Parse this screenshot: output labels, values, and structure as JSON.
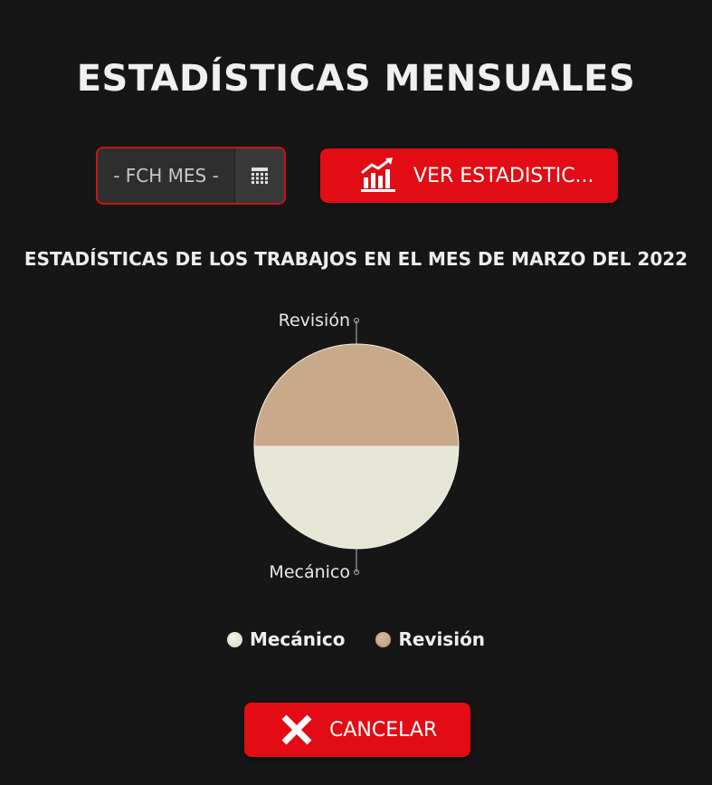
{
  "header": {
    "title": "ESTADÍSTICAS MENSUALES"
  },
  "controls": {
    "date_placeholder": "- FCH MES -",
    "calendar_icon": "calendar-icon",
    "view_button_label": "VER ESTADISTIC...",
    "view_button_icon": "chart-growth-icon",
    "cancel_label": "CANCELAR",
    "cancel_icon": "close-icon"
  },
  "colors": {
    "background": "#161616",
    "accent": "#e20c14",
    "border_accent": "#c81418",
    "revision": "#c8a98a",
    "mecanico": "#e6e6d6"
  },
  "chart_data": {
    "type": "pie",
    "title": "ESTADÍSTICAS DE LOS TRABAJOS EN EL MES DE MARZO DEL 2022",
    "slices": [
      {
        "label": "Revisión",
        "value": 50,
        "color": "#c8a98a"
      },
      {
        "label": "Mecánico",
        "value": 50,
        "color": "#e6e6d6"
      }
    ],
    "legend": [
      "Mecánico",
      "Revisión"
    ],
    "legend_position": "bottom"
  }
}
